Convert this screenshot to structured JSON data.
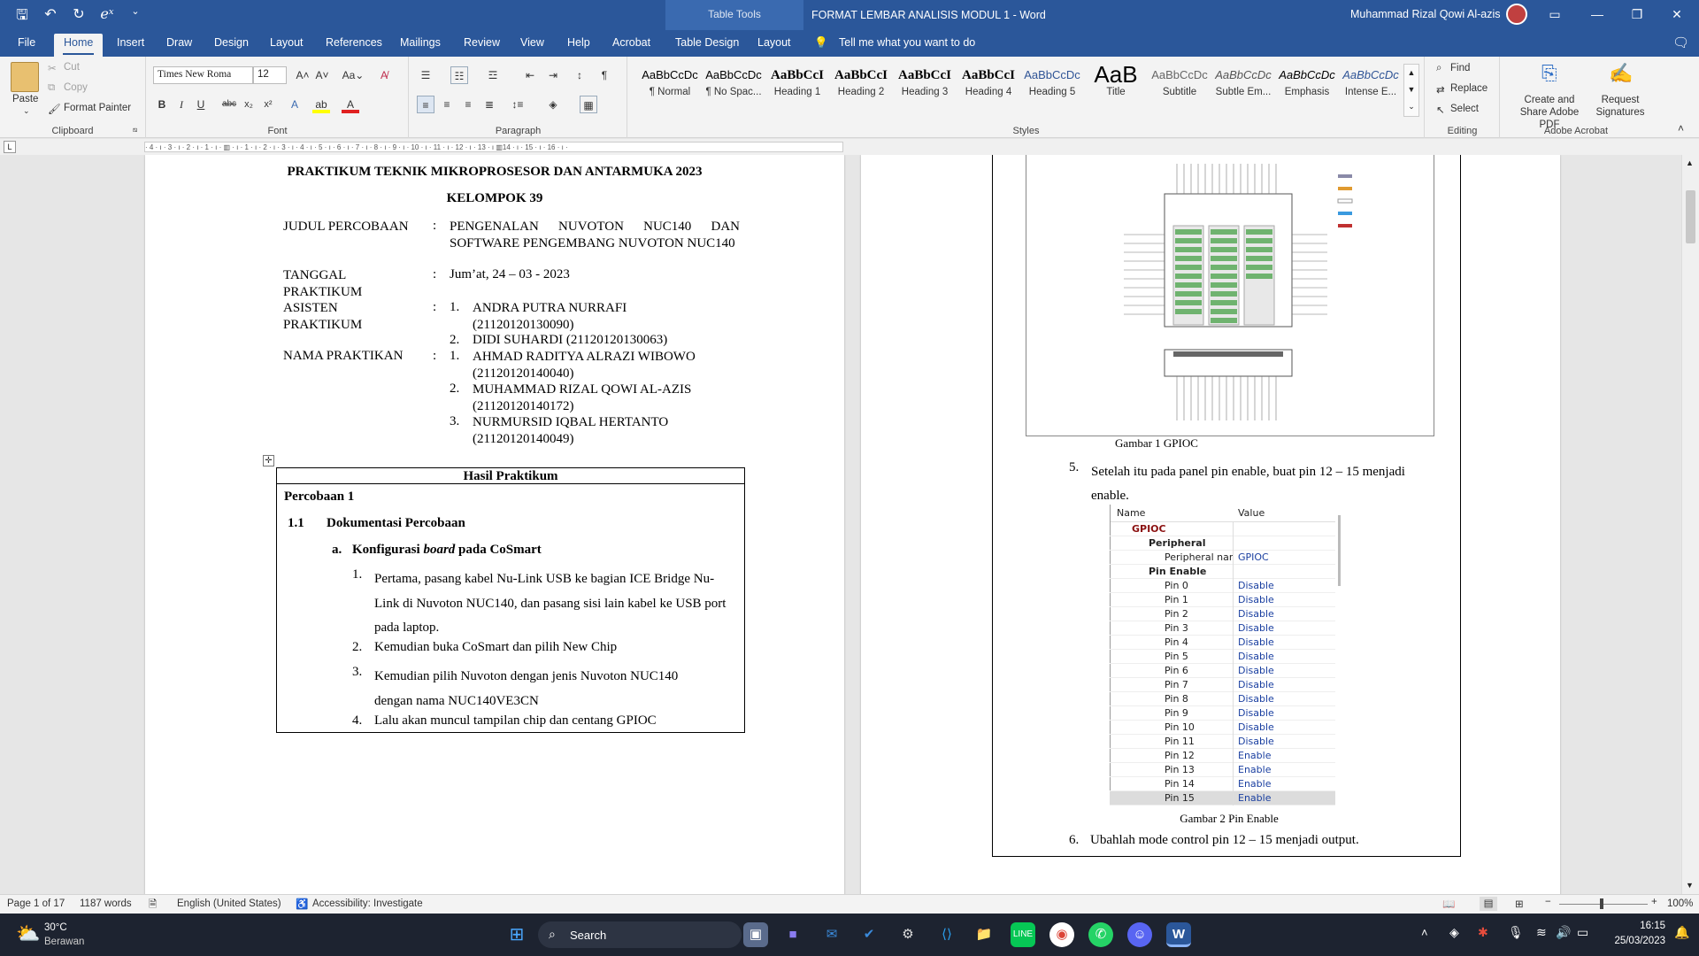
{
  "titlebar": {
    "table_tools": "Table Tools",
    "doc_title": "FORMAT LEMBAR ANALISIS MODUL 1  -  Word",
    "user": "Muhammad Rizal Qowi Al-azis",
    "qat_icons": [
      "save-icon",
      "undo-icon",
      "redo-icon",
      "equation-icon",
      "customize-icon"
    ]
  },
  "tabs": [
    "File",
    "Home",
    "Insert",
    "Draw",
    "Design",
    "Layout",
    "References",
    "Mailings",
    "Review",
    "View",
    "Help",
    "Acrobat",
    "Table Design",
    "Layout"
  ],
  "tell_me": "Tell me what you want to do",
  "ribbon": {
    "clipboard": {
      "paste": "Paste",
      "cut": "Cut",
      "copy": "Copy",
      "format_painter": "Format Painter",
      "label": "Clipboard"
    },
    "font": {
      "name": "Times New Roma",
      "size": "12",
      "label": "Font"
    },
    "paragraph": {
      "label": "Paragraph"
    },
    "styles": {
      "label": "Styles",
      "items": [
        {
          "preview": "AaBbCcDc",
          "name": "¶ Normal"
        },
        {
          "preview": "AaBbCcDc",
          "name": "¶ No Spac..."
        },
        {
          "preview": "AaBbCcI",
          "name": "Heading 1"
        },
        {
          "preview": "AaBbCcI",
          "name": "Heading 2"
        },
        {
          "preview": "AaBbCcI",
          "name": "Heading 3"
        },
        {
          "preview": "AaBbCcI",
          "name": "Heading 4"
        },
        {
          "preview": "AaBbCcDc",
          "name": "Heading 5"
        },
        {
          "preview": "AaB",
          "name": "Title"
        },
        {
          "preview": "AaBbCcDc",
          "name": "Subtitle"
        },
        {
          "preview": "AaBbCcDc",
          "name": "Subtle Em..."
        },
        {
          "preview": "AaBbCcDc",
          "name": "Emphasis"
        },
        {
          "preview": "AaBbCcDc",
          "name": "Intense E..."
        }
      ]
    },
    "editing": {
      "find": "Find",
      "replace": "Replace",
      "select": "Select",
      "label": "Editing"
    },
    "acrobat": {
      "create": "Create and Share Adobe PDF",
      "request": "Request Signatures",
      "label": "Adobe Acrobat"
    }
  },
  "page1": {
    "header1": "PRAKTIKUM TEKNIK MIKROPROSESOR DAN ANTARMUKA 2023",
    "header2": "KELOMPOK 39",
    "judul_label": "JUDUL PERCOBAAN",
    "judul_value": "PENGENALAN NUVOTON NUC140 DAN SOFTWARE PENGEMBANG NUVOTON NUC140",
    "tanggal_label": "TANGGAL PRAKTIKUM",
    "tanggal_value": "Jum’at, 24 – 03 - 2023",
    "asisten_label": "ASISTEN PRAKTIKUM",
    "asisten": [
      "ANDRA PUTRA NURRAFI (21120120130090)",
      "DIDI SUHARDI (21120120130063)"
    ],
    "nama_label": "NAMA PRAKTIKAN",
    "praktikan": [
      "AHMAD RADITYA ALRAZI WIBOWO (21120120140040)",
      "MUHAMMAD RIZAL QOWI AL-AZIS (21120120140172)",
      "NURMURSID IQBAL HERTANTO (21120120140049)"
    ],
    "colon": ":",
    "table_title": "Hasil Praktikum",
    "percobaan": "Percobaan 1",
    "section_num": "1.1",
    "section_title": "Dokumentasi Percobaan",
    "sub_a": "a.",
    "sub_a_pre": "Konfigurasi ",
    "sub_a_italic": "board",
    "sub_a_post": " pada CoSmart",
    "steps": [
      "Pertama, pasang kabel Nu-Link USB ke bagian ICE Bridge Nu-Link di Nuvoton NUC140, dan pasang sisi lain kabel ke USB port pada laptop.",
      "Kemudian buka CoSmart dan pilih New Chip",
      "Kemudian pilih Nuvoton dengan jenis Nuvoton NUC140 dengan nama NUC140VE3CN",
      "Lalu akan muncul tampilan chip dan centang GPIOC"
    ]
  },
  "page2": {
    "caption1": "Gambar 1 GPIOC",
    "step5_num": "5.",
    "step5": "Setelah itu pada panel pin enable, buat pin 12 – 15 menjadi enable.",
    "table_header": [
      "Name",
      "Value"
    ],
    "gpio": "GPIOC",
    "peripheral": "Peripheral",
    "peripheral_name": "Peripheral nam",
    "peripheral_value": "GPIOC",
    "pin_enable": "Pin Enable",
    "pins": [
      {
        "pin": "Pin 0",
        "value": "Disable"
      },
      {
        "pin": "Pin 1",
        "value": "Disable"
      },
      {
        "pin": "Pin 2",
        "value": "Disable"
      },
      {
        "pin": "Pin 3",
        "value": "Disable"
      },
      {
        "pin": "Pin 4",
        "value": "Disable"
      },
      {
        "pin": "Pin 5",
        "value": "Disable"
      },
      {
        "pin": "Pin 6",
        "value": "Disable"
      },
      {
        "pin": "Pin 7",
        "value": "Disable"
      },
      {
        "pin": "Pin 8",
        "value": "Disable"
      },
      {
        "pin": "Pin 9",
        "value": "Disable"
      },
      {
        "pin": "Pin 10",
        "value": "Disable"
      },
      {
        "pin": "Pin 11",
        "value": "Disable"
      },
      {
        "pin": "Pin 12",
        "value": "Enable"
      },
      {
        "pin": "Pin 13",
        "value": "Enable"
      },
      {
        "pin": "Pin 14",
        "value": "Enable"
      },
      {
        "pin": "Pin 15",
        "value": "Enable"
      }
    ],
    "caption2": "Gambar 2 Pin Enable",
    "step6_num": "6.",
    "step6": "Ubahlah mode control pin 12 – 15 menjadi output."
  },
  "status": {
    "page": "Page 1 of 17",
    "words": "1187 words",
    "language": "English (United States)",
    "accessibility": "Accessibility: Investigate",
    "zoom": "100%"
  },
  "taskbar": {
    "temp": "30°C",
    "weather": "Berawan",
    "search": "Search",
    "time": "16:15",
    "date": "25/03/2023"
  }
}
